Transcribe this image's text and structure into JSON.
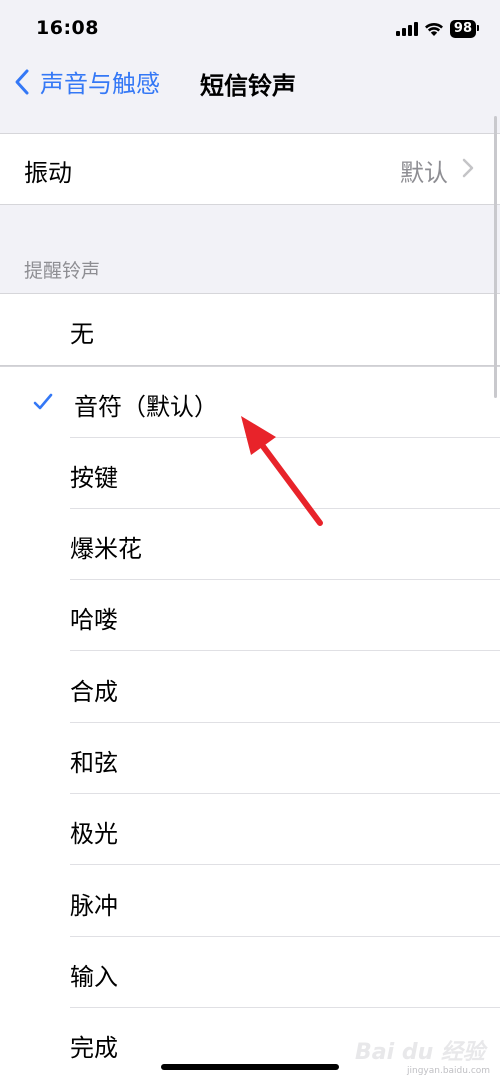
{
  "status_bar": {
    "time": "16:08",
    "battery": "98"
  },
  "nav": {
    "back_label": "声音与触感",
    "title": "短信铃声"
  },
  "vibration": {
    "label": "振动",
    "value": "默认"
  },
  "section_header": "提醒铃声",
  "none_option": "无",
  "tones": [
    {
      "label": "音符（默认）",
      "selected": true
    },
    {
      "label": "按键",
      "selected": false
    },
    {
      "label": "爆米花",
      "selected": false
    },
    {
      "label": "哈喽",
      "selected": false
    },
    {
      "label": "合成",
      "selected": false
    },
    {
      "label": "和弦",
      "selected": false
    },
    {
      "label": "极光",
      "selected": false
    },
    {
      "label": "脉冲",
      "selected": false
    },
    {
      "label": "输入",
      "selected": false
    },
    {
      "label": "完成",
      "selected": false
    }
  ],
  "colors": {
    "accent": "#3478f6",
    "arrow": "#e8232a",
    "background": "#f2f2f7"
  },
  "watermark": {
    "text": "Bai du 经验",
    "url": "jingyan.baidu.com"
  }
}
